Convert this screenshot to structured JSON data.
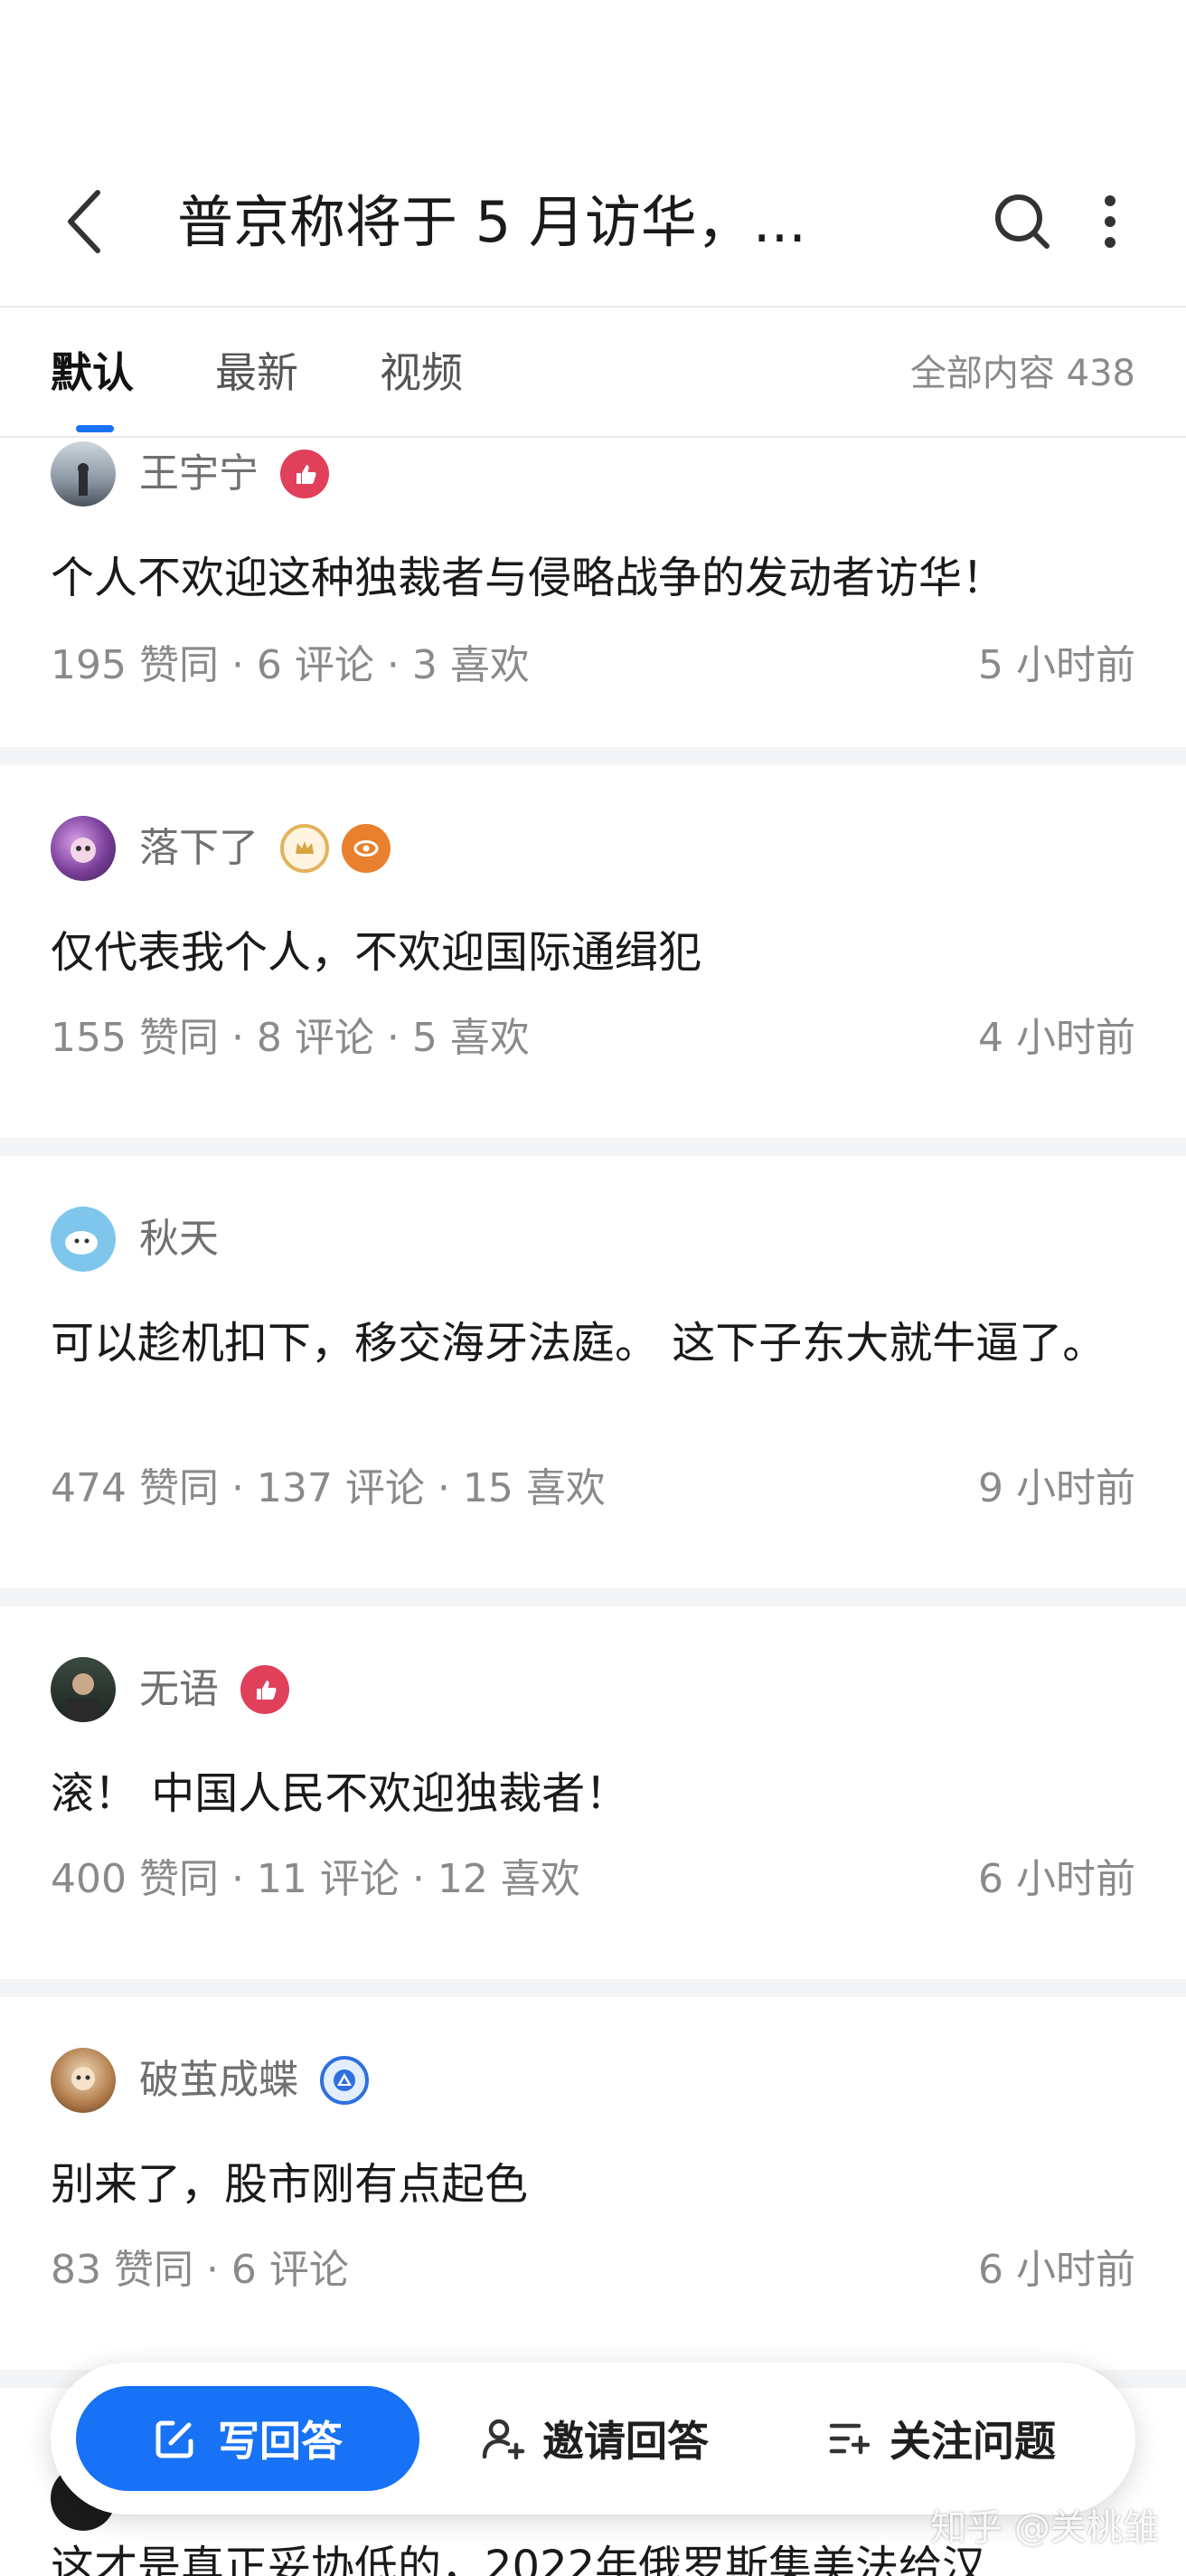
{
  "header": {
    "title": "普京称将于 5 月访华，..."
  },
  "tabs": [
    {
      "label": "默认",
      "active": true
    },
    {
      "label": "最新",
      "active": false
    },
    {
      "label": "视频",
      "active": false
    }
  ],
  "total_count_label": "全部内容 438",
  "answers": [
    {
      "author": "王宇宁",
      "badge": "red-thumb-badge",
      "text": "个人不欢迎这种独裁者与侵略战争的发动者访华！",
      "meta": "195  赞同 · 6  评论 · 3  喜欢",
      "time": "5 小时前"
    },
    {
      "author": "落下了",
      "badge": "crown-badge",
      "text": "仅代表我个人，不欢迎国际通缉犯",
      "meta": "155  赞同 · 8  评论 · 5  喜欢",
      "time": "4 小时前"
    },
    {
      "author": "秋天",
      "badge": "",
      "text": "可以趁机扣下，移交海牙法庭。 这下子东大就牛逼了。",
      "meta": "474  赞同 · 137  评论 · 15  喜欢",
      "time": "9 小时前"
    },
    {
      "author": "无语",
      "badge": "red-thumb-badge",
      "text": "滚！ 中国人民不欢迎独裁者！",
      "meta": "400  赞同 · 11  评论 · 12  喜欢",
      "time": "6 小时前"
    },
    {
      "author": "破茧成蝶",
      "badge": "blue-triangle-badge",
      "text": "别来了，股市刚有点起色",
      "meta": "83  赞同 · 6  评论",
      "time": "6 小时前"
    }
  ],
  "partial_text": "这才是真正妥协低的，2022年俄罗斯集美法给汉",
  "actions": {
    "write": "写回答",
    "invite": "邀请回答",
    "follow": "关注问题"
  },
  "watermark": "知乎 @关桃雏",
  "colors": {
    "accent": "#1772f6",
    "muted_text": "#8a8a8a",
    "badge_red": "#e0405a",
    "badge_gold": "#d9a441",
    "badge_orange": "#e8802e",
    "badge_blue": "#2f6fe0"
  }
}
